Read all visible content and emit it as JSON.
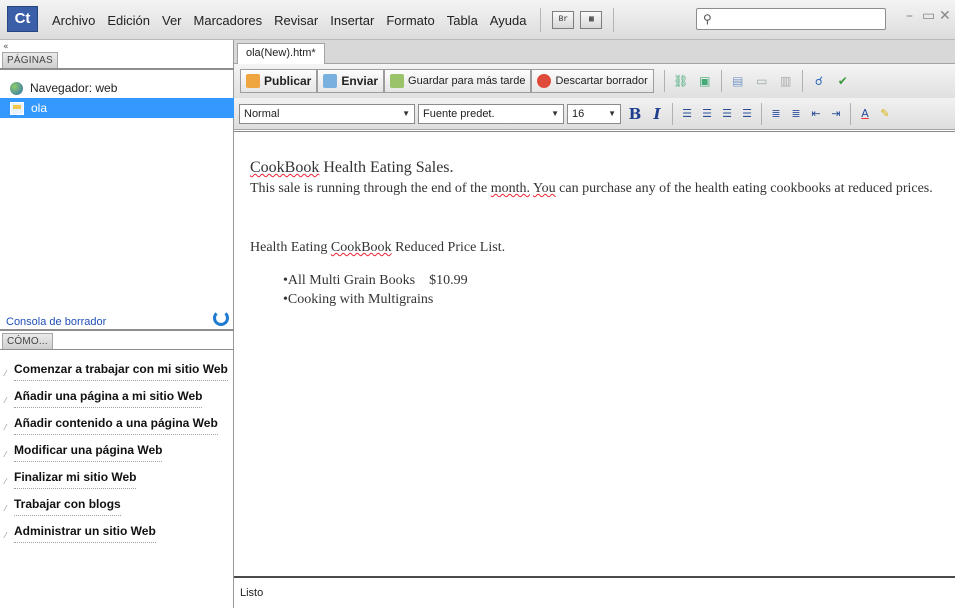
{
  "app": {
    "logo": "Ct"
  },
  "menu": [
    "Archivo",
    "Edición",
    "Ver",
    "Marcadores",
    "Revisar",
    "Insertar",
    "Formato",
    "Tabla",
    "Ayuda"
  ],
  "menu_icons": {
    "bridge": "Br"
  },
  "search": {
    "placeholder": ""
  },
  "window": {
    "minimize": "–",
    "maximize": "▭",
    "close": "✕"
  },
  "left_panel": {
    "pages_title": "PÁGINAS",
    "pages": [
      {
        "label": "Navegador: web",
        "icon": "globe-icon"
      },
      {
        "label": "ola",
        "icon": "page-icon",
        "selected": true
      }
    ],
    "console_label": "Consola de borrador",
    "howto_title": "CÓMO...",
    "howto_items": [
      "Comenzar a trabajar con mi sitio Web",
      "Añadir una página a mi sitio Web",
      "Añadir contenido a una página Web",
      "Modificar una página Web",
      "Finalizar mi sitio Web",
      "Trabajar con blogs",
      "Administrar un sitio Web"
    ]
  },
  "doc_tab": "ola(New).htm*",
  "toolbar1": {
    "publish": "Publicar",
    "send": "Enviar",
    "save_later": "Guardar para más tarde",
    "discard": "Descartar borrador"
  },
  "toolbar2": {
    "style": "Normal",
    "font": "Fuente predet.",
    "size": "16"
  },
  "content": {
    "heading_a": "CookBook",
    "heading_b": " Health Eating Sales.",
    "p1_a": "This sale is running through the end of the ",
    "p1_b": "month.",
    "p1_c": " ",
    "p1_d": "You",
    "p1_e": " can purchase any of the health eating cookbooks at reduced prices.",
    "list_title_a": "Health Eating ",
    "list_title_b": "CookBook",
    "list_title_c": " Reduced Price List.",
    "item1": "•All Multi Grain Books    $10.99",
    "item2": "•Cooking with Multigrains"
  },
  "status": "Listo",
  "colors": {
    "selection": "#3399ff",
    "link": "#1f4fb7",
    "logo_bg": "#3a5fa8"
  }
}
